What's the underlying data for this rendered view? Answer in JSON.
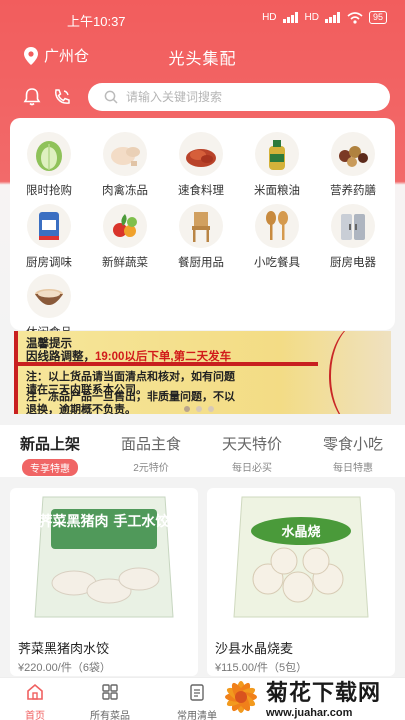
{
  "status_bar": {
    "time": "上午10:37",
    "network1": "HD",
    "network2": "HD",
    "battery": "95"
  },
  "header": {
    "location": "广州仓",
    "title": "光头集配"
  },
  "search": {
    "placeholder": "请输入关键词搜索"
  },
  "categories": [
    {
      "label": "限时抢购",
      "icon": "cabbage-icon"
    },
    {
      "label": "肉禽冻品",
      "icon": "chicken-icon"
    },
    {
      "label": "速食料理",
      "icon": "cooked-meat-icon"
    },
    {
      "label": "米面粮油",
      "icon": "oil-bottle-icon"
    },
    {
      "label": "营养药膳",
      "icon": "herbs-icon"
    },
    {
      "label": "厨房调味",
      "icon": "seasoning-bag-icon"
    },
    {
      "label": "新鲜蔬菜",
      "icon": "vegetables-icon"
    },
    {
      "label": "餐厨用品",
      "icon": "chair-icon"
    },
    {
      "label": "小吃餐具",
      "icon": "utensils-icon"
    },
    {
      "label": "厨房电器",
      "icon": "fridge-icon"
    },
    {
      "label": "休闲食品",
      "icon": "snack-bowl-icon"
    }
  ],
  "notice": {
    "title": "温馨提示",
    "line1_prefix": "因线路调整，",
    "line1_highlight": "19:00以后下单,第二天发车",
    "note1a": "注：以上货品请当面清点和核对，如有问题",
    "note1b": "请在三天内联系本公司。",
    "note2a": "注：冻品产品一旦售出，非质量问题，不以",
    "note2b": "退换，逾期概不负责。"
  },
  "tabs": [
    {
      "label": "新品上架",
      "sub": "专享特惠"
    },
    {
      "label": "面品主食",
      "sub": "2元特价"
    },
    {
      "label": "天天特价",
      "sub": "每日必买"
    },
    {
      "label": "零食小吃",
      "sub": "每日特惠"
    }
  ],
  "products": [
    {
      "name": "荠菜黑猪肉水饺",
      "price": "¥220.00/件（6袋）",
      "package_text": "荠菜黑猪肉 手工水饺"
    },
    {
      "name": "沙县水晶烧麦",
      "price": "¥115.00/件（5包）",
      "package_text": "水晶烧"
    }
  ],
  "bottom_nav": [
    {
      "label": "首页"
    },
    {
      "label": "所有菜品"
    },
    {
      "label": "常用清单"
    }
  ],
  "watermark": {
    "brand": "菊花下载网",
    "url": "www.juahar.com"
  },
  "colors": {
    "brand_red": "#f25d5d",
    "highlight_red": "#d11b1b",
    "notice_yellow": "#f6e69a"
  }
}
